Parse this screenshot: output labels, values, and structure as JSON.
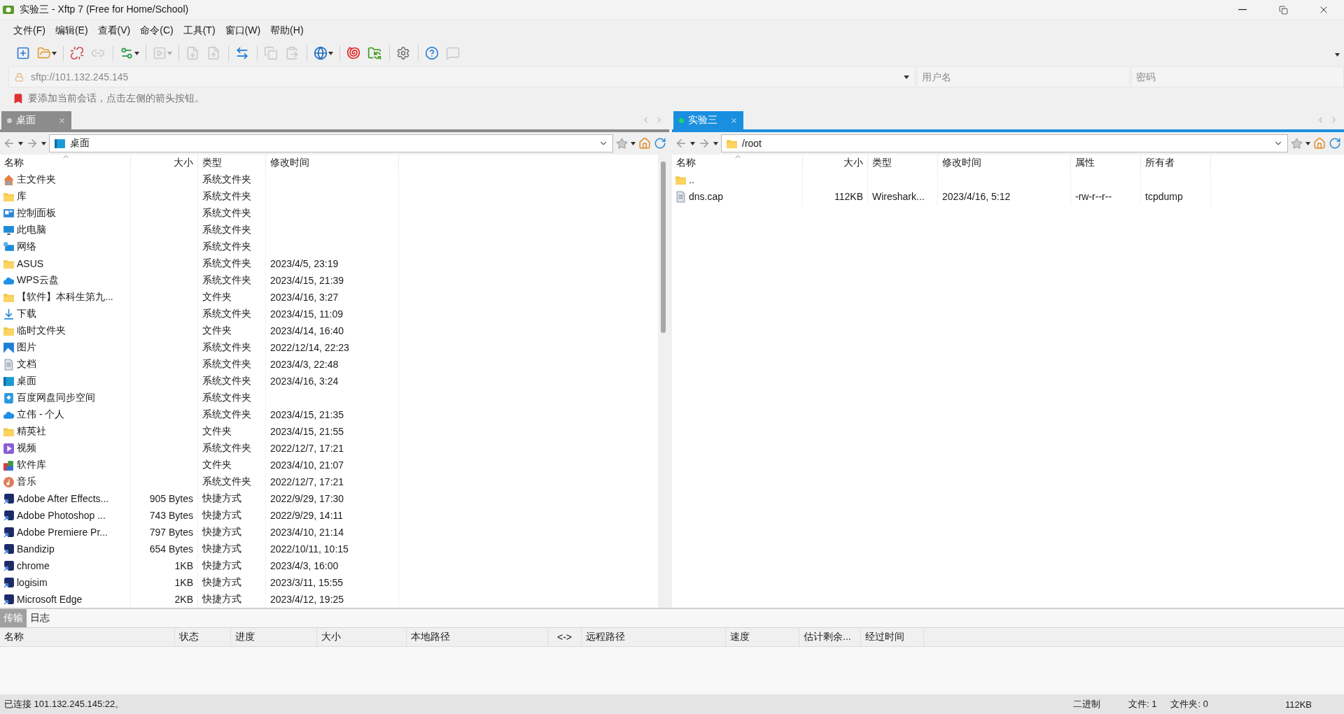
{
  "window": {
    "title": "实验三 - Xftp 7 (Free for Home/School)"
  },
  "menu": [
    "文件(F)",
    "编辑(E)",
    "查看(V)",
    "命令(C)",
    "工具(T)",
    "窗口(W)",
    "帮助(H)"
  ],
  "toolbar": [
    {
      "kind": "new-session",
      "disabled": false,
      "dropdown": false
    },
    {
      "kind": "open",
      "disabled": false,
      "dropdown": true
    },
    {
      "kind": "separator"
    },
    {
      "kind": "disconnect",
      "disabled": false,
      "dropdown": false
    },
    {
      "kind": "reconnect",
      "disabled": true,
      "dropdown": false
    },
    {
      "kind": "separator"
    },
    {
      "kind": "properties",
      "disabled": false,
      "dropdown": true
    },
    {
      "kind": "separator"
    },
    {
      "kind": "transfer",
      "disabled": true,
      "dropdown": true
    },
    {
      "kind": "separator"
    },
    {
      "kind": "download",
      "disabled": true,
      "dropdown": false
    },
    {
      "kind": "upload",
      "disabled": true,
      "dropdown": false
    },
    {
      "kind": "separator"
    },
    {
      "kind": "sync",
      "disabled": false,
      "dropdown": false
    },
    {
      "kind": "separator"
    },
    {
      "kind": "copy",
      "disabled": true,
      "dropdown": false
    },
    {
      "kind": "paste",
      "disabled": true,
      "dropdown": false
    },
    {
      "kind": "separator"
    },
    {
      "kind": "globe",
      "disabled": false,
      "dropdown": true
    },
    {
      "kind": "separator"
    },
    {
      "kind": "shell",
      "disabled": false,
      "dropdown": false
    },
    {
      "kind": "ftp",
      "disabled": false,
      "dropdown": false
    },
    {
      "kind": "separator"
    },
    {
      "kind": "settings",
      "disabled": false,
      "dropdown": false
    },
    {
      "kind": "separator"
    },
    {
      "kind": "help",
      "disabled": false,
      "dropdown": false
    },
    {
      "kind": "chat",
      "disabled": true,
      "dropdown": false
    }
  ],
  "address": {
    "value": "sftp://101.132.245.145",
    "username_placeholder": "用户名",
    "password_placeholder": "密码"
  },
  "hint": "要添加当前会话，点击左侧的箭头按钮。",
  "panes": [
    {
      "tab": "桌面",
      "active": false,
      "connected": false,
      "path": {
        "kind": "desktop",
        "text": "桌面"
      },
      "scrollbar": true,
      "columns": [
        {
          "label": "名称",
          "sorted": true
        },
        {
          "label": "大小",
          "sorted": false
        },
        {
          "label": "类型",
          "sorted": false
        },
        {
          "label": "修改时间",
          "sorted": false
        }
      ],
      "rows": [
        {
          "kind": "home",
          "cells": [
            "主文件夹",
            "",
            "系统文件夹",
            ""
          ]
        },
        {
          "kind": "folder",
          "cells": [
            "库",
            "",
            "系统文件夹",
            ""
          ]
        },
        {
          "kind": "panel",
          "cells": [
            "控制面板",
            "",
            "系统文件夹",
            ""
          ]
        },
        {
          "kind": "monitor",
          "cells": [
            "此电脑",
            "",
            "系统文件夹",
            ""
          ]
        },
        {
          "kind": "network",
          "cells": [
            "网络",
            "",
            "系统文件夹",
            ""
          ]
        },
        {
          "kind": "folder",
          "cells": [
            "ASUS",
            "",
            "系统文件夹",
            "2023/4/5, 23:19"
          ]
        },
        {
          "kind": "cloud",
          "cells": [
            "WPS云盘",
            "",
            "系统文件夹",
            "2023/4/15, 21:39"
          ]
        },
        {
          "kind": "folder",
          "cells": [
            "【软件】本科生第九...",
            "",
            "文件夹",
            "2023/4/16, 3:27"
          ]
        },
        {
          "kind": "download",
          "cells": [
            "下载",
            "",
            "系统文件夹",
            "2023/4/15, 11:09"
          ]
        },
        {
          "kind": "folder",
          "cells": [
            "临时文件夹",
            "",
            "文件夹",
            "2023/4/14, 16:40"
          ]
        },
        {
          "kind": "image",
          "cells": [
            "图片",
            "",
            "系统文件夹",
            "2022/12/14, 22:23"
          ]
        },
        {
          "kind": "document",
          "cells": [
            "文档",
            "",
            "系统文件夹",
            "2023/4/3, 22:48"
          ]
        },
        {
          "kind": "desktop",
          "cells": [
            "桌面",
            "",
            "系统文件夹",
            "2023/4/16, 3:24"
          ]
        },
        {
          "kind": "sync",
          "cells": [
            "百度网盘同步空间",
            "",
            "系统文件夹",
            ""
          ]
        },
        {
          "kind": "cloud",
          "cells": [
            "立伟 - 个人",
            "",
            "系统文件夹",
            "2023/4/15, 21:35"
          ]
        },
        {
          "kind": "folder",
          "cells": [
            "精英社",
            "",
            "文件夹",
            "2023/4/15, 21:55"
          ]
        },
        {
          "kind": "video",
          "cells": [
            "视频",
            "",
            "系统文件夹",
            "2022/12/7, 17:21"
          ]
        },
        {
          "kind": "apps",
          "cells": [
            "软件库",
            "",
            "文件夹",
            "2023/4/10, 21:07"
          ]
        },
        {
          "kind": "music",
          "cells": [
            "音乐",
            "",
            "系统文件夹",
            "2022/12/7, 17:21"
          ]
        },
        {
          "kind": "shortcut",
          "cells": [
            "Adobe After Effects...",
            "905 Bytes",
            "快捷方式",
            "2022/9/29, 17:30"
          ]
        },
        {
          "kind": "shortcut",
          "cells": [
            "Adobe Photoshop ...",
            "743 Bytes",
            "快捷方式",
            "2022/9/29, 14:11"
          ]
        },
        {
          "kind": "shortcut",
          "cells": [
            "Adobe Premiere Pr...",
            "797 Bytes",
            "快捷方式",
            "2023/4/10, 21:14"
          ]
        },
        {
          "kind": "shortcut",
          "cells": [
            "Bandizip",
            "654 Bytes",
            "快捷方式",
            "2022/10/11, 10:15"
          ]
        },
        {
          "kind": "shortcut",
          "cells": [
            "chrome",
            "1KB",
            "快捷方式",
            "2023/4/3, 16:00"
          ]
        },
        {
          "kind": "shortcut",
          "cells": [
            "logisim",
            "1KB",
            "快捷方式",
            "2023/3/11, 15:55"
          ]
        },
        {
          "kind": "shortcut",
          "cells": [
            "Microsoft Edge",
            "2KB",
            "快捷方式",
            "2023/4/12, 19:25"
          ]
        }
      ]
    },
    {
      "tab": "实验三",
      "active": true,
      "connected": true,
      "path": {
        "kind": "folder",
        "text": "/root"
      },
      "scrollbar": false,
      "columns": [
        {
          "label": "名称",
          "sorted": true
        },
        {
          "label": "大小",
          "sorted": false
        },
        {
          "label": "类型",
          "sorted": false
        },
        {
          "label": "修改时间",
          "sorted": false
        },
        {
          "label": "属性",
          "sorted": false
        },
        {
          "label": "所有者",
          "sorted": false
        }
      ],
      "rows": [
        {
          "kind": "folder",
          "cells": [
            "..",
            "",
            "",
            "",
            "",
            ""
          ]
        },
        {
          "kind": "document",
          "cells": [
            "dns.cap",
            "112KB",
            "Wireshark...",
            "2023/4/16, 5:12",
            "-rw-r--r--",
            "tcpdump"
          ]
        }
      ]
    }
  ],
  "bottom_tabs": [
    {
      "label": "传输",
      "selected": true
    },
    {
      "label": "日志",
      "selected": false
    }
  ],
  "transfer_columns": [
    "名称",
    "状态",
    "进度",
    "大小",
    "本地路径",
    "<->",
    "远程路径",
    "速度",
    "估计剩余...",
    "经过时间"
  ],
  "status_bar": {
    "connection": "已连接 101.132.245.145:22。",
    "mode": "二进制",
    "files": "文件: 1",
    "folders": "文件夹: 0",
    "size": "112KB"
  }
}
